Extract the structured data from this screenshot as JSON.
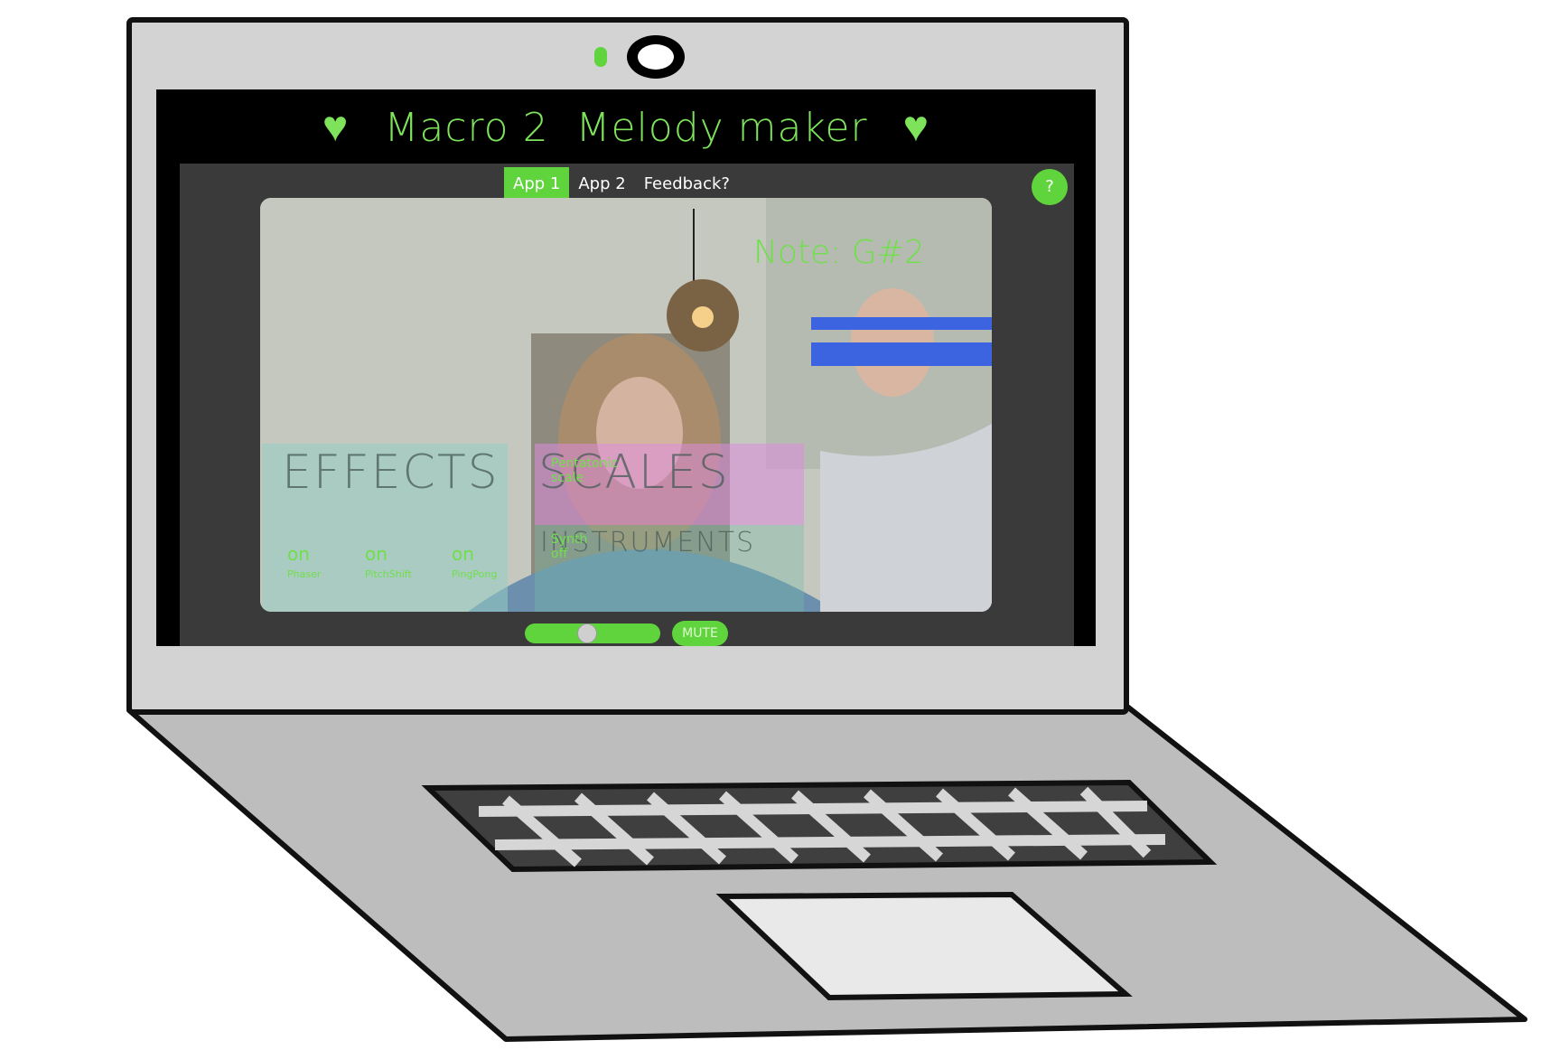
{
  "app": {
    "heart_left": "♥",
    "heart_right": "♥",
    "title": "Macro 2  Melody maker"
  },
  "tabs": [
    {
      "label": "App 1",
      "active": true
    },
    {
      "label": "App 2",
      "active": false
    },
    {
      "label": "Feedback?",
      "active": false
    }
  ],
  "help_button": {
    "label": "?"
  },
  "video": {
    "note_readout": "Note: G#2",
    "zones": {
      "effects": {
        "title": "EFFECTS",
        "toggles": [
          {
            "state": "on",
            "name": "Phaser"
          },
          {
            "state": "on",
            "name": "PitchShift"
          },
          {
            "state": "on",
            "name": "PingPong"
          }
        ]
      },
      "scales": {
        "title": "SCALES",
        "caption": "Pentatonic scale"
      },
      "instruments": {
        "title": "INSTRUMENTS",
        "caption": "Synth off"
      }
    }
  },
  "volume_slider": {
    "level": 0.45
  },
  "mute_button": {
    "label": "MUTE"
  },
  "colors": {
    "accent": "#5fd43c",
    "text_green": "#6fe04a",
    "pitch_bar": "#3c63e0",
    "screen_bg": "#000000",
    "panel_bg": "#3a3a3a"
  }
}
